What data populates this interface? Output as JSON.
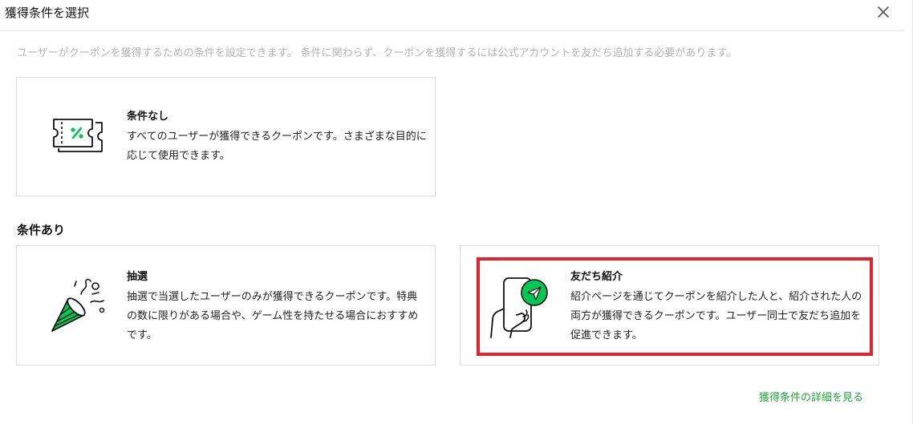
{
  "dialog": {
    "title": "獲得条件を選択",
    "description": "ユーザーがクーポンを獲得するための条件を設定できます。 条件に関わらず、クーポンを獲得するには公式アカウントを友だち追加する必要があります。"
  },
  "options": {
    "no_condition": {
      "title": "条件なし",
      "description": "すべてのユーザーが獲得できるクーポンです。さまざまな目的に応じて使用できます。",
      "icon": "coupon-ticket-icon"
    },
    "with_condition_heading": "条件あり",
    "lottery": {
      "title": "抽選",
      "description": "抽選で当選したユーザーのみが獲得できるクーポンです。特典の数に限りがある場合や、ゲーム性を持たせる場合におすすめです。",
      "icon": "party-popper-icon"
    },
    "friend_referral": {
      "title": "友だち紹介",
      "description": "紹介ページを通じてクーポンを紹介した人と、紹介された人の両方が獲得できるクーポンです。ユーザー同士で友だち追加を促進できます。",
      "icon": "phone-share-icon",
      "highlighted": true
    }
  },
  "footer": {
    "details_link": "獲得条件の詳細を見る"
  },
  "colors": {
    "accent_green": "#1fa43b",
    "icon_green": "#06c755",
    "highlight_red": "#e0242f",
    "muted_text": "#b4b4b4"
  }
}
